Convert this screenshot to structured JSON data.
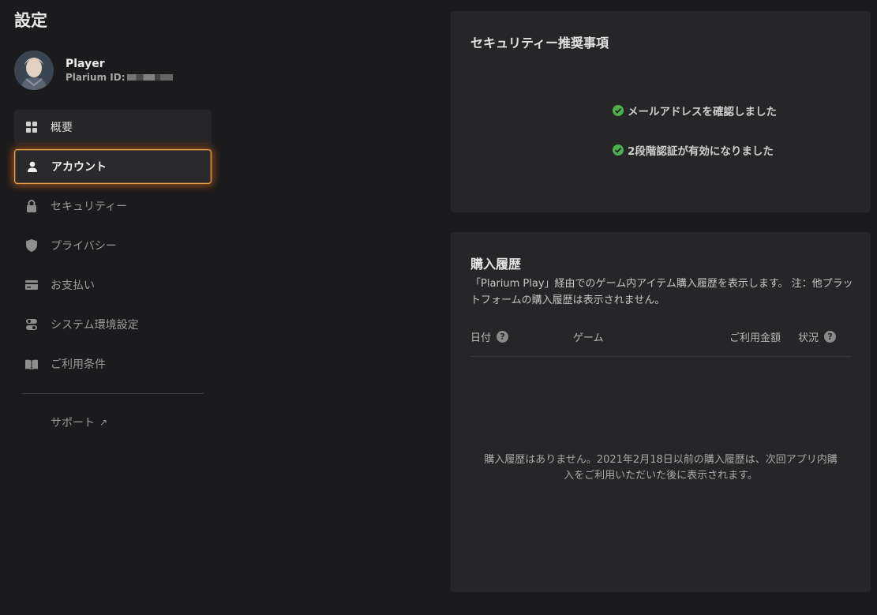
{
  "page": {
    "title": "設定"
  },
  "profile": {
    "name": "Player",
    "id_label": "Plarium ID:"
  },
  "nav": {
    "items": [
      {
        "label": "概要",
        "icon": "grid-icon"
      },
      {
        "label": "アカウント",
        "icon": "user-icon"
      },
      {
        "label": "セキュリティー",
        "icon": "lock-icon"
      },
      {
        "label": "プライバシー",
        "icon": "shield-icon"
      },
      {
        "label": "お支払い",
        "icon": "credit-card-icon"
      },
      {
        "label": "システム環境設定",
        "icon": "toggle-icon"
      },
      {
        "label": "ご利用条件",
        "icon": "book-icon"
      }
    ],
    "support_label": "サポート",
    "support_icon": "external-arrow-icon"
  },
  "security": {
    "title": "セキュリティー推奨事項",
    "items": [
      {
        "label": "メールアドレスを確認しました",
        "icon": "check-circle-icon"
      },
      {
        "label": "2段階認証が有効になりました",
        "icon": "check-circle-icon"
      }
    ]
  },
  "history": {
    "title": "購入履歴",
    "description": "「Plarium Play」経由でのゲーム内アイテム購入履歴を表示します。 注：他プラットフォームの購入履歴は表示されません。",
    "columns": {
      "date": "日付",
      "game": "ゲーム",
      "amount": "ご利用金額",
      "status": "状況"
    },
    "empty_message": "購入履歴はありません。2021年2月18日以前の購入履歴は、次回アプリ内購入をご利用いただいた後に表示されます。"
  },
  "colors": {
    "background": "#1b1b1d",
    "card": "#262628",
    "accent_glow": "#f0a24a",
    "check_green": "#4caf50"
  }
}
